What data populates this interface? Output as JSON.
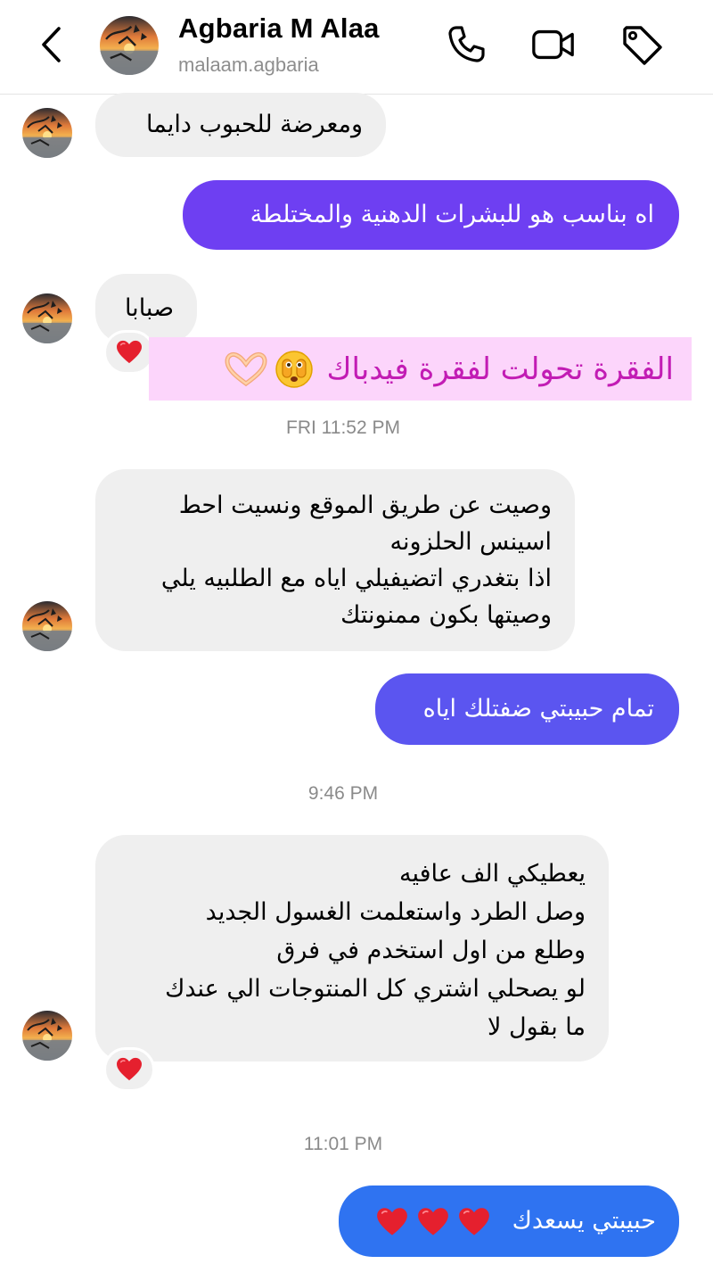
{
  "header": {
    "name": "Agbaria M Alaa",
    "handle": "malaam.agbaria",
    "icons": [
      "back-chevron-icon",
      "phone-icon",
      "video-camera-icon",
      "tag-icon"
    ]
  },
  "messages": [
    {
      "side": "received",
      "text": "ومعرضة للحبوب دايما"
    },
    {
      "side": "sent",
      "text": "اه بناسب هو للبشرات الدهنية والمختلطة"
    },
    {
      "side": "received",
      "text": "صبابا",
      "reaction": "heart"
    },
    {
      "side": "received",
      "text": "وصيت عن طريق الموقع ونسيت احط\nاسينس الحلزونه\nاذا بتغدري اتضيفيلي اياه مع الطلبيه يلي\nوصيتها بكون ممنونتك"
    },
    {
      "side": "sent",
      "text": "تمام حبيبتي ضفتلك اياه"
    },
    {
      "side": "received",
      "text": "يعطيكي الف عافيه\nوصل الطرد واستعلمت الغسول الجديد\nوطلع من اول استخدم في فرق\nلو يصحلي اشتري كل المنتوجات الي عندك\nما بقول لا",
      "reaction": "heart"
    },
    {
      "side": "sent",
      "text": "حبيبتي يسعدك",
      "trailing_emoji": [
        "heart",
        "heart",
        "heart"
      ]
    }
  ],
  "timestamps": [
    "FRI 11:52 PM",
    "9:46 PM",
    "11:01 PM"
  ],
  "overlay": {
    "text": "الفقرة تحولت لفقرة فيدباك",
    "emoji": [
      "face-with-open-eyes-and-hand-over-mouth-emoji",
      "heart-hands-emoji"
    ],
    "background": "#fcd5fb",
    "color": "#c21cb4"
  },
  "colors": {
    "sent_1": "#6e3ff2",
    "sent_2": "#5b55f0",
    "sent_3": "#2f73f1",
    "received": "#efefef",
    "heart": "#e5202e"
  }
}
